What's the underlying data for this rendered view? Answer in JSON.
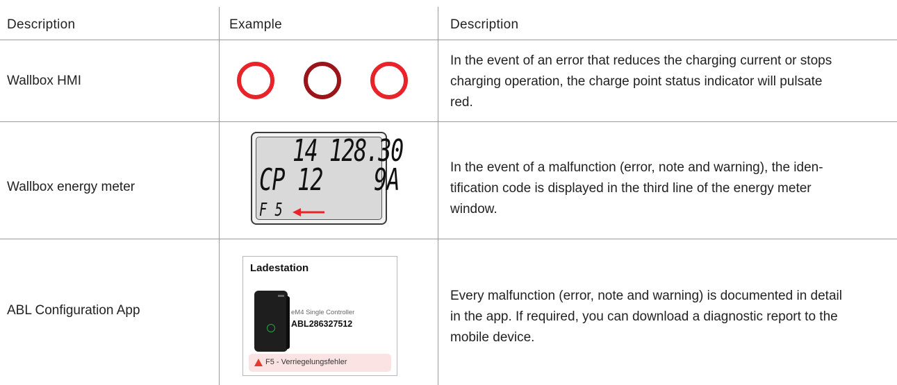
{
  "header": {
    "col1": "Description",
    "col2": "Example",
    "col3": "Description"
  },
  "rows": [
    {
      "label": "Wallbox HMI",
      "description": [
        "In the event of an error that reduces the charging current or stops",
        "charging operation, the charge point status indicator will pulsate",
        "red."
      ],
      "rings": [
        {
          "color": "#e8232a",
          "icon": "status-ring-bright-red"
        },
        {
          "color": "#9b141a",
          "icon": "status-ring-dark-red"
        },
        {
          "color": "#e8232a",
          "icon": "status-ring-bright-red"
        }
      ]
    },
    {
      "label": "Wallbox energy meter",
      "description": [
        "In the event of a malfunction (error, note and warning), the iden-",
        "tification code is displayed in the third line of the energy meter",
        "window."
      ],
      "lcd": {
        "line1": "14 128.30",
        "line2": "CP 12    9A",
        "line3": "F 5",
        "arrow_color": "#e8232a"
      }
    },
    {
      "label": "ABL Configuration App",
      "description": [
        "Every malfunction (error, note and warning) is documented in detail",
        "in the app. If required, you can download a diagnostic report to the",
        "mobile device."
      ],
      "app": {
        "title": "Ladestation",
        "subtitle": "eM4 Single Controller",
        "device_id": "ABL286327512",
        "alert": "F5 - Verriegelungsfehler",
        "alert_color": "#e23b30",
        "alert_bg": "#fbe3e3"
      }
    }
  ],
  "colors": {
    "grid": "#9a9a9a",
    "text": "#222222"
  }
}
